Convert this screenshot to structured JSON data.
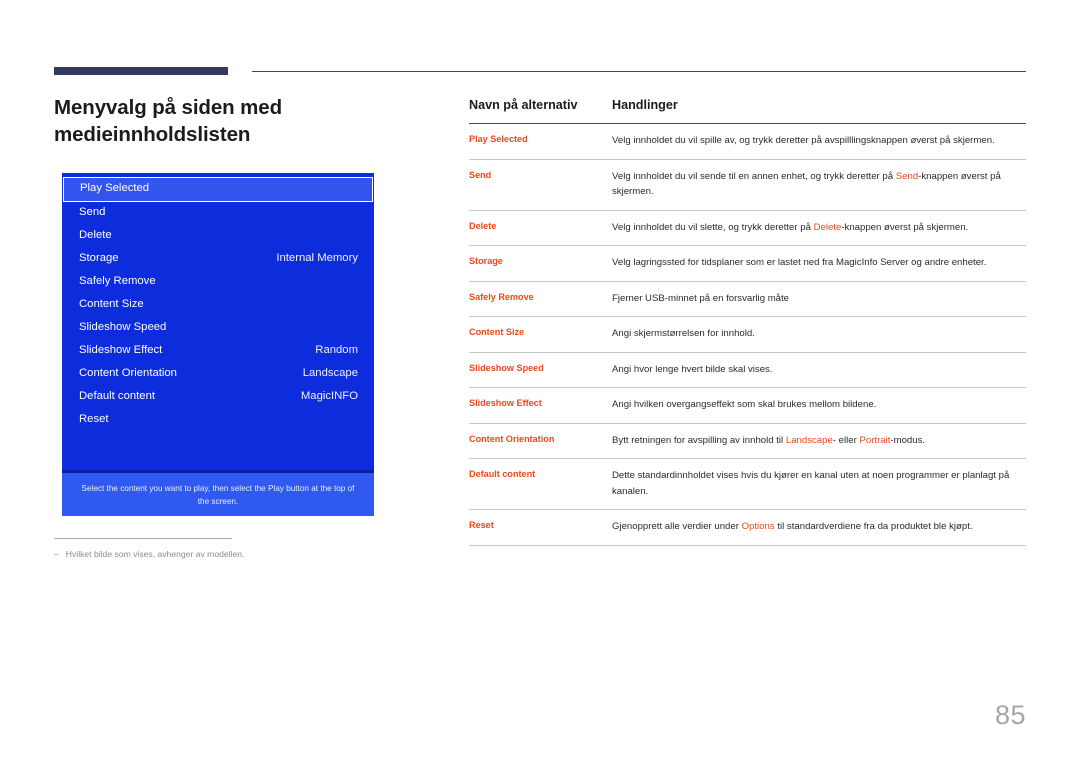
{
  "page": {
    "title": "Menyvalg på siden med medieinnholdslisten",
    "number": "85"
  },
  "tv_panel": {
    "selected_index": 0,
    "menu": [
      {
        "label": "Play Selected",
        "value": ""
      },
      {
        "label": "Send",
        "value": ""
      },
      {
        "label": "Delete",
        "value": ""
      },
      {
        "label": "Storage",
        "value": "Internal Memory"
      },
      {
        "label": "Safely Remove",
        "value": ""
      },
      {
        "label": "Content Size",
        "value": ""
      },
      {
        "label": "Slideshow Speed",
        "value": ""
      },
      {
        "label": "Slideshow Effect",
        "value": "Random"
      },
      {
        "label": "Content Orientation",
        "value": "Landscape"
      },
      {
        "label": "Default content",
        "value": "MagicINFO"
      },
      {
        "label": "Reset",
        "value": ""
      }
    ],
    "hint": "Select the content you want to play, then select the Play button at the top of the screen.",
    "colors": {
      "panel_bg": "#0d2ddd",
      "selected_bg": "#3355ee",
      "hint_bg": "#2f59f0",
      "border": "#ffffff"
    }
  },
  "footnote": {
    "dash": "‒",
    "text": "Hvilket bilde som vises, avhenger av modellen."
  },
  "table": {
    "headers": [
      "Navn på alternativ",
      "Handlinger"
    ],
    "rows": [
      {
        "name": "Play Selected",
        "desc_parts": [
          {
            "t": "Velg innholdet du vil spille av, og trykk deretter på avspilllingsknappen øverst på skjermen.",
            "hl": false
          }
        ]
      },
      {
        "name": "Send",
        "desc_parts": [
          {
            "t": "Velg innholdet du vil sende til en annen enhet, og trykk deretter på ",
            "hl": false
          },
          {
            "t": "Send",
            "hl": true
          },
          {
            "t": "-knappen øverst på skjermen.",
            "hl": false
          }
        ]
      },
      {
        "name": "Delete",
        "desc_parts": [
          {
            "t": "Velg innholdet du vil slette, og trykk deretter på ",
            "hl": false
          },
          {
            "t": "Delete",
            "hl": true
          },
          {
            "t": "-knappen øverst på skjermen.",
            "hl": false
          }
        ]
      },
      {
        "name": "Storage",
        "desc_parts": [
          {
            "t": "Velg lagringssted for tidsplaner som er lastet ned fra MagicInfo Server og andre enheter.",
            "hl": false
          }
        ]
      },
      {
        "name": "Safely Remove",
        "desc_parts": [
          {
            "t": "Fjerner USB-minnet på en forsvarlig måte",
            "hl": false
          }
        ]
      },
      {
        "name": "Content Size",
        "desc_parts": [
          {
            "t": "Angi skjermstørrelsen for innhold.",
            "hl": false
          }
        ]
      },
      {
        "name": "Slideshow Speed",
        "desc_parts": [
          {
            "t": "Angi hvor lenge hvert bilde skal vises.",
            "hl": false
          }
        ]
      },
      {
        "name": "Slideshow Effect",
        "desc_parts": [
          {
            "t": "Angi hvilken overgangseffekt som skal brukes mellom bildene.",
            "hl": false
          }
        ]
      },
      {
        "name": "Content Orientation",
        "desc_parts": [
          {
            "t": "Bytt retningen for avspilling av innhold til ",
            "hl": false
          },
          {
            "t": "Landscape",
            "hl": true
          },
          {
            "t": "- eller ",
            "hl": false
          },
          {
            "t": "Portrait",
            "hl": true
          },
          {
            "t": "-modus.",
            "hl": false
          }
        ]
      },
      {
        "name": "Default content",
        "desc_parts": [
          {
            "t": "Dette standardinnholdet vises hvis du kjører en kanal uten at noen programmer er planlagt på kanalen.",
            "hl": false
          }
        ]
      },
      {
        "name": "Reset",
        "desc_parts": [
          {
            "t": "Gjenopprett alle verdier under ",
            "hl": false
          },
          {
            "t": "Options",
            "hl": true
          },
          {
            "t": " til standardverdiene fra da produktet ble kjøpt.",
            "hl": false
          }
        ]
      }
    ]
  }
}
